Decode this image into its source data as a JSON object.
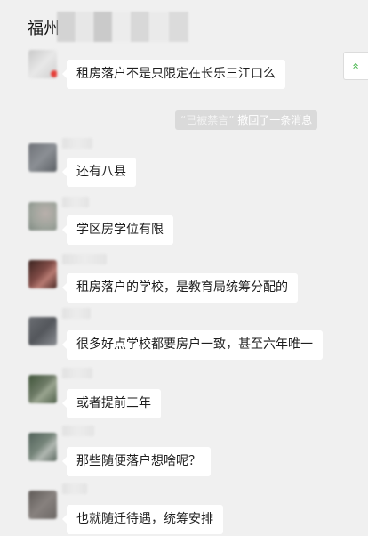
{
  "header": {
    "title": "福州"
  },
  "scroll_button": {
    "icon": "double-chevron-up-icon",
    "glyph": "≫"
  },
  "system_message": {
    "quoted_name": "“已被禁言”",
    "text": " 撤回了一条消息"
  },
  "messages": [
    {
      "text": "租房落户不是只限定在长乐三江口么"
    },
    {
      "text": "还有八县"
    },
    {
      "text": "学区房学位有限"
    },
    {
      "text": "租房落户的学校，是教育局统筹分配的"
    },
    {
      "text": "很多好点学校都要房户一致，甚至六年唯一"
    },
    {
      "text": "或者提前三年"
    },
    {
      "text": "那些随便落户想啥呢？"
    },
    {
      "text": "也就随迁待遇，统筹安排"
    }
  ],
  "colors": {
    "background": "#f0f0f0",
    "bubble": "#ffffff",
    "accent": "#44b549"
  }
}
